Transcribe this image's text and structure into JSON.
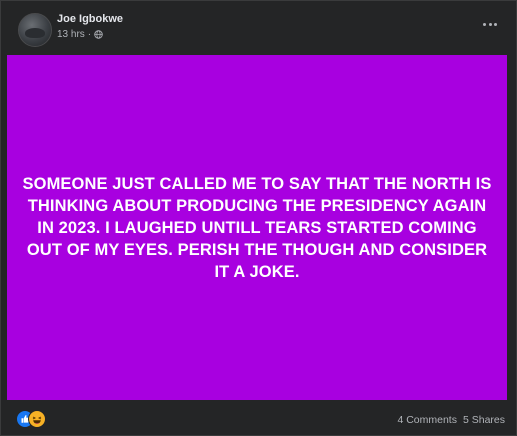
{
  "post": {
    "author": "Joe Igbokwe",
    "time": "13 hrs",
    "separator": "·",
    "privacy_icon": "globe-icon",
    "background_color": "#a800e0",
    "text": "SOMEONE JUST CALLED ME TO SAY THAT THE NORTH IS THINKING ABOUT PRODUCING THE PRESIDENCY AGAIN IN 2023. I LAUGHED UNTILL TEARS STARTED COMING OUT OF MY EYES. PERISH THE THOUGH AND CONSIDER IT A JOKE."
  },
  "footer": {
    "reaction_icons": [
      "like-icon",
      "haha-icon"
    ],
    "comments": "4 Comments",
    "shares": "5 Shares"
  },
  "colors": {
    "card": "#242526",
    "text_primary": "#e4e6eb",
    "text_secondary": "#b0b3b8",
    "like_blue": "#1877f2",
    "haha_yellow": "#f7b125"
  }
}
